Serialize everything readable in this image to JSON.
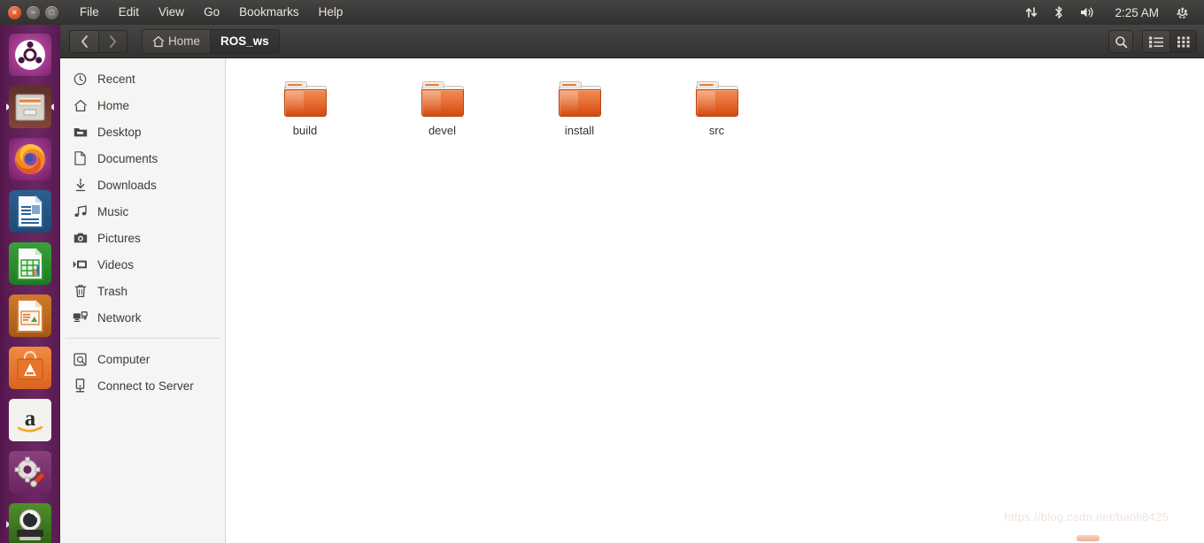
{
  "panel": {
    "window_controls": [
      {
        "name": "close",
        "glyph": "×"
      },
      {
        "name": "minimize",
        "glyph": "−"
      },
      {
        "name": "maximize",
        "glyph": "□"
      }
    ],
    "menus": [
      "File",
      "Edit",
      "View",
      "Go",
      "Bookmarks",
      "Help"
    ],
    "tray": {
      "network_icon": "network-updown-icon",
      "bluetooth_icon": "bluetooth-icon",
      "volume_icon": "volume-icon",
      "clock": "2:25 AM",
      "session_icon": "session-gear-power-icon"
    }
  },
  "launcher": {
    "items": [
      {
        "name": "ubuntu-dash",
        "label": "Dash Home"
      },
      {
        "name": "files",
        "label": "Files",
        "running": true,
        "focused": true
      },
      {
        "name": "firefox",
        "label": "Firefox Web Browser"
      },
      {
        "name": "libreoffice-writer",
        "label": "LibreOffice Writer"
      },
      {
        "name": "libreoffice-calc",
        "label": "LibreOffice Calc"
      },
      {
        "name": "libreoffice-impress",
        "label": "LibreOffice Impress"
      },
      {
        "name": "ubuntu-software",
        "label": "Ubuntu Software"
      },
      {
        "name": "amazon",
        "label": "Amazon"
      },
      {
        "name": "system-settings",
        "label": "System Settings"
      },
      {
        "name": "software-updater",
        "label": "Software Updater",
        "running": true
      }
    ]
  },
  "toolbar": {
    "back_label": "‹",
    "forward_label": "›",
    "breadcrumbs": [
      {
        "label": "Home",
        "icon": "home-icon",
        "active": false
      },
      {
        "label": "ROS_ws",
        "icon": "",
        "active": true
      }
    ],
    "search_icon": "search-icon",
    "list_view_icon": "list-view-icon",
    "grid_view_icon": "grid-view-icon"
  },
  "sidebar": {
    "items": [
      {
        "label": "Recent",
        "icon": "clock-icon"
      },
      {
        "label": "Home",
        "icon": "home-icon"
      },
      {
        "label": "Desktop",
        "icon": "desktop-folder-icon"
      },
      {
        "label": "Documents",
        "icon": "document-icon"
      },
      {
        "label": "Downloads",
        "icon": "download-icon"
      },
      {
        "label": "Music",
        "icon": "music-note-icon"
      },
      {
        "label": "Pictures",
        "icon": "camera-icon"
      },
      {
        "label": "Videos",
        "icon": "video-icon"
      },
      {
        "label": "Trash",
        "icon": "trash-icon"
      },
      {
        "label": "Network",
        "icon": "network-icon"
      }
    ],
    "items_bottom": [
      {
        "label": "Computer",
        "icon": "computer-icon"
      },
      {
        "label": "Connect to Server",
        "icon": "server-icon"
      }
    ]
  },
  "content": {
    "files": [
      {
        "name": "build",
        "type": "folder"
      },
      {
        "name": "devel",
        "type": "folder"
      },
      {
        "name": "install",
        "type": "folder"
      },
      {
        "name": "src",
        "type": "folder"
      }
    ]
  },
  "watermark": {
    "text": "https://blog.csdn.net/baoli8425"
  },
  "colors": {
    "panel_bg": "#3b3937",
    "launcher_bg": "#5b1c53",
    "sidebar_bg": "#f6f5f3",
    "content_bg": "#ffffff",
    "folder_orange": "#e9743b",
    "close_red": "#df5529"
  }
}
